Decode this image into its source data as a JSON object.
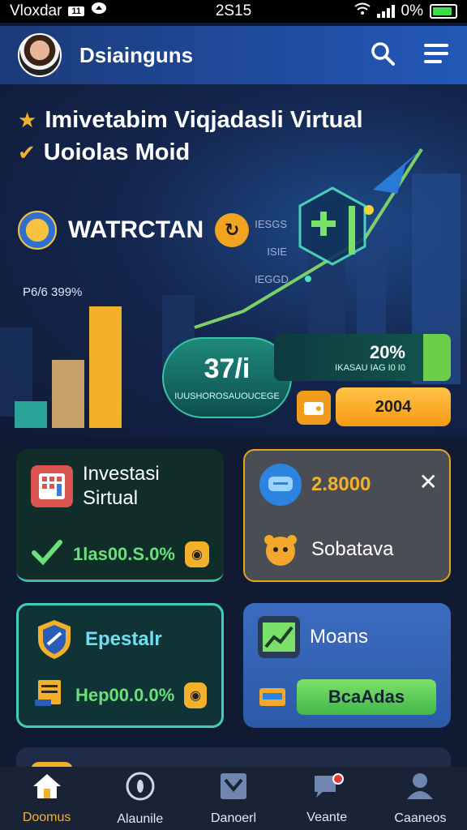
{
  "status_bar": {
    "carrier": "Vloxdar",
    "sim_label": "11",
    "time": "2S15",
    "battery_text": "0%",
    "battery_level": 0.9
  },
  "app_bar": {
    "title": "Dsiainguns",
    "search_icon": "search-icon",
    "menu_icon": "menu-icon"
  },
  "hero": {
    "bullets": [
      "Imivetabim Viqjadasli Virtual",
      "Uoiolas Moid"
    ],
    "brand": "WATRCTAN",
    "growth_label": "P6/6 399%",
    "side_labels": [
      "IESGS",
      "ISIE",
      "IEGGD"
    ],
    "pill_value": "37/i",
    "pill_caption": "IUUSHOROSAUOUCEGE",
    "stat_percent": "20%",
    "stat_caption": "IKASAU IAG I0 I0",
    "orange_button": "2004",
    "bars": [
      22,
      56,
      100
    ]
  },
  "cards": {
    "investasi": {
      "title_1": "Investasi",
      "title_2": "Sirtual",
      "value": "1las00.S.0%"
    },
    "sobatava": {
      "value": "2.8000",
      "label": "Sobatava"
    },
    "epestalr": {
      "title": "Epestalr",
      "value": "Hep00.0.0%"
    },
    "moans": {
      "title": "Moans",
      "button": "BcaAdas"
    }
  },
  "nav": {
    "items": [
      {
        "label": "Doomus",
        "icon": "home-icon"
      },
      {
        "label": "Alaunile",
        "icon": "compass-icon"
      },
      {
        "label": "Danoerl",
        "icon": "inbox-icon"
      },
      {
        "label": "Veante",
        "icon": "chat-icon"
      },
      {
        "label": "Caaneos",
        "icon": "profile-icon"
      }
    ]
  },
  "colors": {
    "accent": "#f3b12b",
    "appbar": "#2358b8",
    "teal": "#3bbfae",
    "green": "#69e07a"
  }
}
